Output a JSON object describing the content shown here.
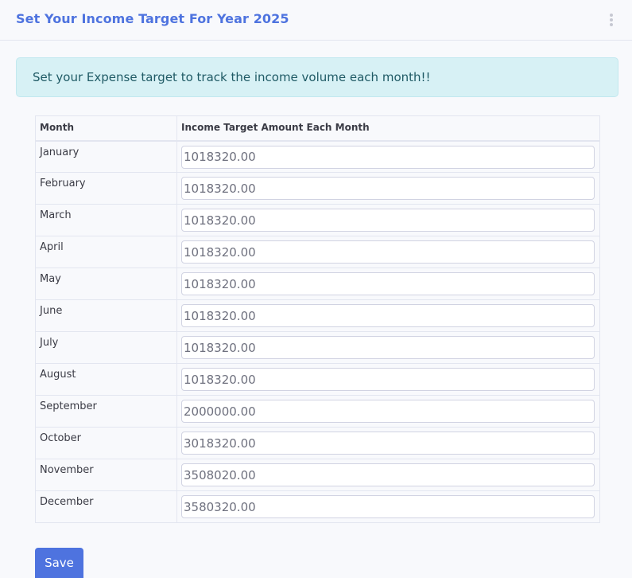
{
  "header": {
    "title": "Set Your Income Target For Year 2025",
    "menu_icon": "vertical-dots-icon"
  },
  "alert": {
    "text": "Set your Expense target to track the income volume each month!!"
  },
  "table": {
    "columns": [
      "Month",
      "Income Target Amount Each Month"
    ],
    "rows": [
      {
        "month": "January",
        "amount": "1018320.00"
      },
      {
        "month": "February",
        "amount": "1018320.00"
      },
      {
        "month": "March",
        "amount": "1018320.00"
      },
      {
        "month": "April",
        "amount": "1018320.00"
      },
      {
        "month": "May",
        "amount": "1018320.00"
      },
      {
        "month": "June",
        "amount": "1018320.00"
      },
      {
        "month": "July",
        "amount": "1018320.00"
      },
      {
        "month": "August",
        "amount": "1018320.00"
      },
      {
        "month": "September",
        "amount": "2000000.00"
      },
      {
        "month": "October",
        "amount": "3018320.00"
      },
      {
        "month": "November",
        "amount": "3508020.00"
      },
      {
        "month": "December",
        "amount": "3580320.00"
      }
    ]
  },
  "actions": {
    "save_label": "Save"
  },
  "colors": {
    "primary": "#4e73df",
    "alert_bg": "#d7f1f5",
    "alert_text": "#1f5a65"
  }
}
